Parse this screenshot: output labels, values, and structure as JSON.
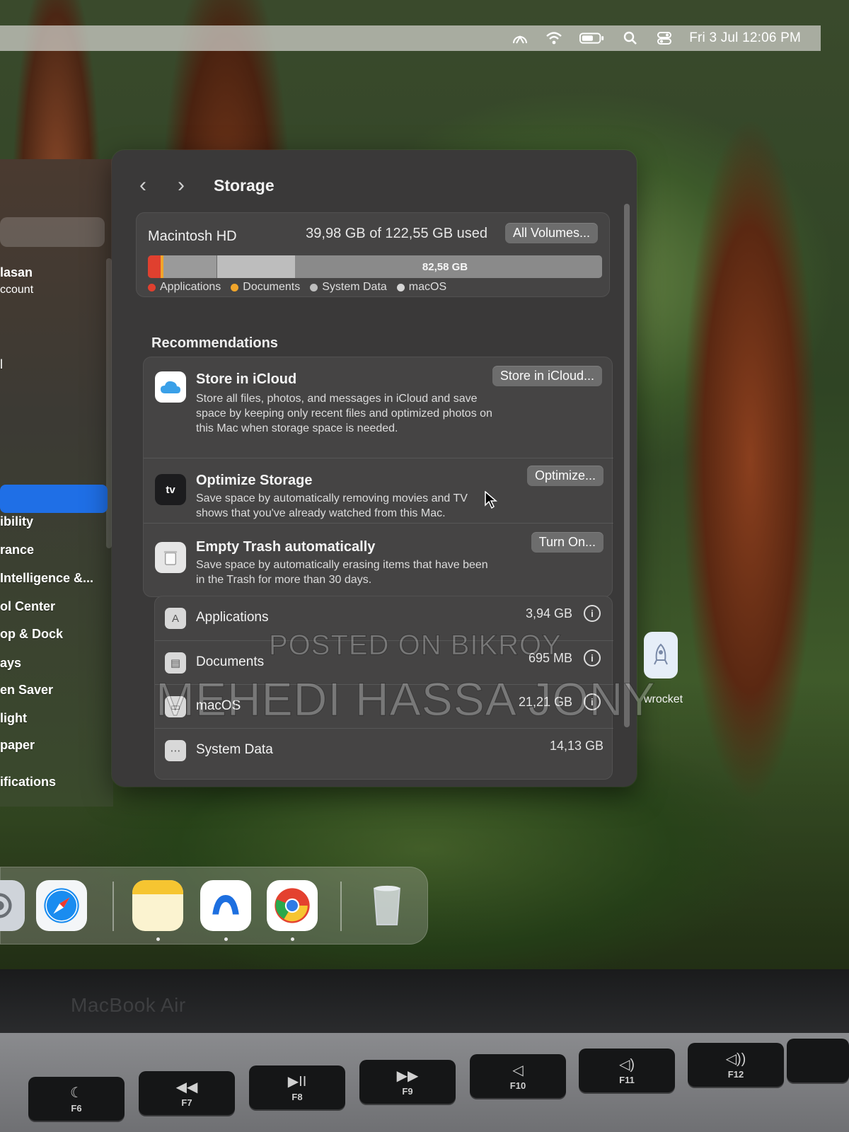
{
  "menubar": {
    "clock": "Fri 3 Jul  12:06 PM",
    "icons": [
      "control-icon",
      "wifi-icon",
      "battery-icon",
      "search-icon",
      "control-center-icon"
    ]
  },
  "sidebar": {
    "user_name": "lasan",
    "user_sub": "ccount",
    "items": [
      "ibility",
      "rance",
      "Intelligence &...",
      "ol Center",
      "op & Dock",
      "ays",
      "en Saver",
      "light",
      "paper",
      "ifications"
    ],
    "partial_item": "l"
  },
  "toolbar": {
    "back": "‹",
    "forward": "›",
    "title": "Storage"
  },
  "disk": {
    "name": "Macintosh HD",
    "usage": "39,98 GB of 122,55 GB used",
    "all_volumes": "All Volumes...",
    "free_label": "82,58 GB",
    "legend": {
      "apps": "Applications",
      "docs": "Documents",
      "system": "System Data",
      "macos": "macOS"
    },
    "colors": {
      "apps": "#e0402f",
      "docs": "#f0a52b",
      "system": "#9a9a9a",
      "macos": "#bdbdbd"
    }
  },
  "recommendations": {
    "title": "Recommendations",
    "icloud": {
      "title": "Store in iCloud",
      "desc": "Store all files, photos, and messages in iCloud and save space by keeping only recent files and optimized photos on this Mac when storage space is needed.",
      "button": "Store in iCloud..."
    },
    "optimize": {
      "title": "Optimize Storage",
      "desc": "Save space by automatically removing movies and TV shows that you've already watched from this Mac.",
      "button": "Optimize...",
      "icon_text": "tv"
    },
    "trash": {
      "title": "Empty Trash automatically",
      "desc": "Save space by automatically erasing items that have been in the Trash for more than 30 days.",
      "button": "Turn On..."
    }
  },
  "categories": [
    {
      "label": "Applications",
      "size": "3,94 GB"
    },
    {
      "label": "Documents",
      "size": "695 MB"
    },
    {
      "label": "macOS",
      "size": "21,21 GB"
    },
    {
      "label": "System Data",
      "size": "14,13 GB"
    }
  ],
  "watermark": {
    "line1": "POSTED ON BIKROY",
    "line2": "MEHEDI HASSA JONY"
  },
  "side_app_label": "wrocket",
  "bezel_label": "MacBook Air",
  "keys": [
    {
      "glyph": "☾",
      "label": "F6"
    },
    {
      "glyph": "◀◀",
      "label": "F7"
    },
    {
      "glyph": "▶II",
      "label": "F8"
    },
    {
      "glyph": "▶▶",
      "label": "F9"
    },
    {
      "glyph": "◁",
      "label": "F10"
    },
    {
      "glyph": "◁)",
      "label": "F11"
    },
    {
      "glyph": "◁))",
      "label": "F12"
    }
  ]
}
